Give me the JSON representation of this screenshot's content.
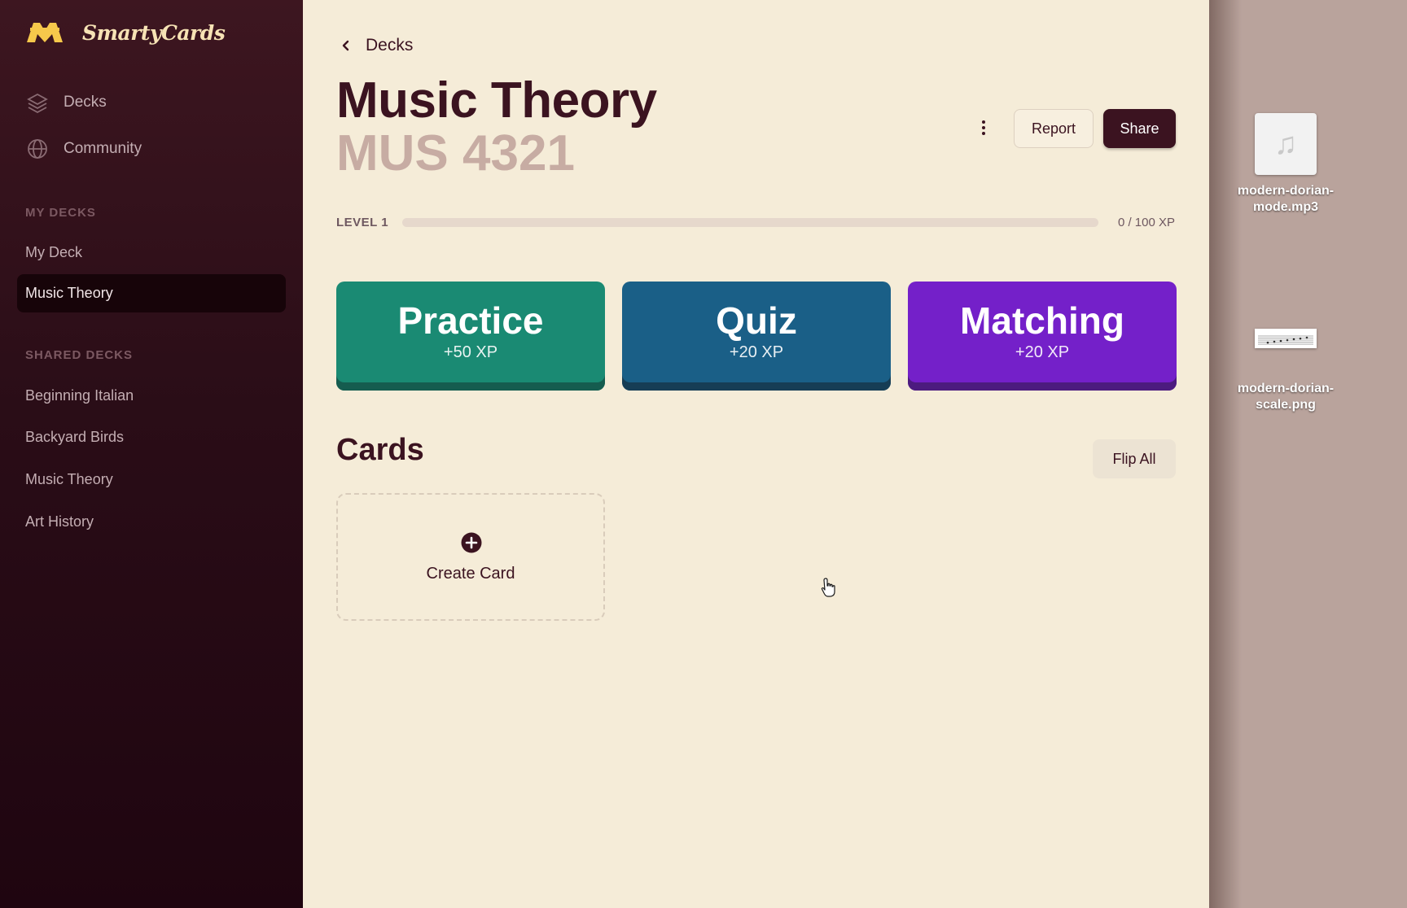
{
  "app": {
    "brand": "SmartyCards"
  },
  "sidebar": {
    "nav": [
      {
        "label": "Decks",
        "icon": "layers-icon"
      },
      {
        "label": "Community",
        "icon": "globe-icon"
      }
    ],
    "my_decks_label": "MY DECKS",
    "my_decks": [
      "My Deck",
      "Music Theory"
    ],
    "active_deck": "Music Theory",
    "shared_decks_label": "SHARED DECKS",
    "shared_decks": [
      "Beginning Italian",
      "Backyard Birds",
      "Music Theory",
      "Art History"
    ]
  },
  "main": {
    "back_label": "Decks",
    "title": "Music Theory",
    "subtitle": "MUS 4321",
    "report_label": "Report",
    "share_label": "Share",
    "level_label": "LEVEL 1",
    "xp_text": "0 / 100 XP",
    "xp_progress": 0,
    "modes": [
      {
        "title": "Practice",
        "xp": "+50 XP",
        "color": "#1a8a73"
      },
      {
        "title": "Quiz",
        "xp": "+20 XP",
        "color": "#1a5f87"
      },
      {
        "title": "Matching",
        "xp": "+20 XP",
        "color": "#7420c9"
      }
    ],
    "cards_heading": "Cards",
    "flip_all_label": "Flip All",
    "create_card_label": "Create Card"
  },
  "desktop": {
    "files": [
      {
        "name_line1": "modern-dorian-",
        "name_line2": "mode.mp3",
        "icon": "music-note-icon"
      },
      {
        "name_line1": "modern-dorian-",
        "name_line2": "scale.png",
        "icon": "image-thumbnail"
      }
    ]
  },
  "colors": {
    "sidebar_bg": "#2a0d17",
    "main_bg": "#f5ecd8",
    "primary": "#3b1320",
    "subtitle": "#c7aca3"
  }
}
